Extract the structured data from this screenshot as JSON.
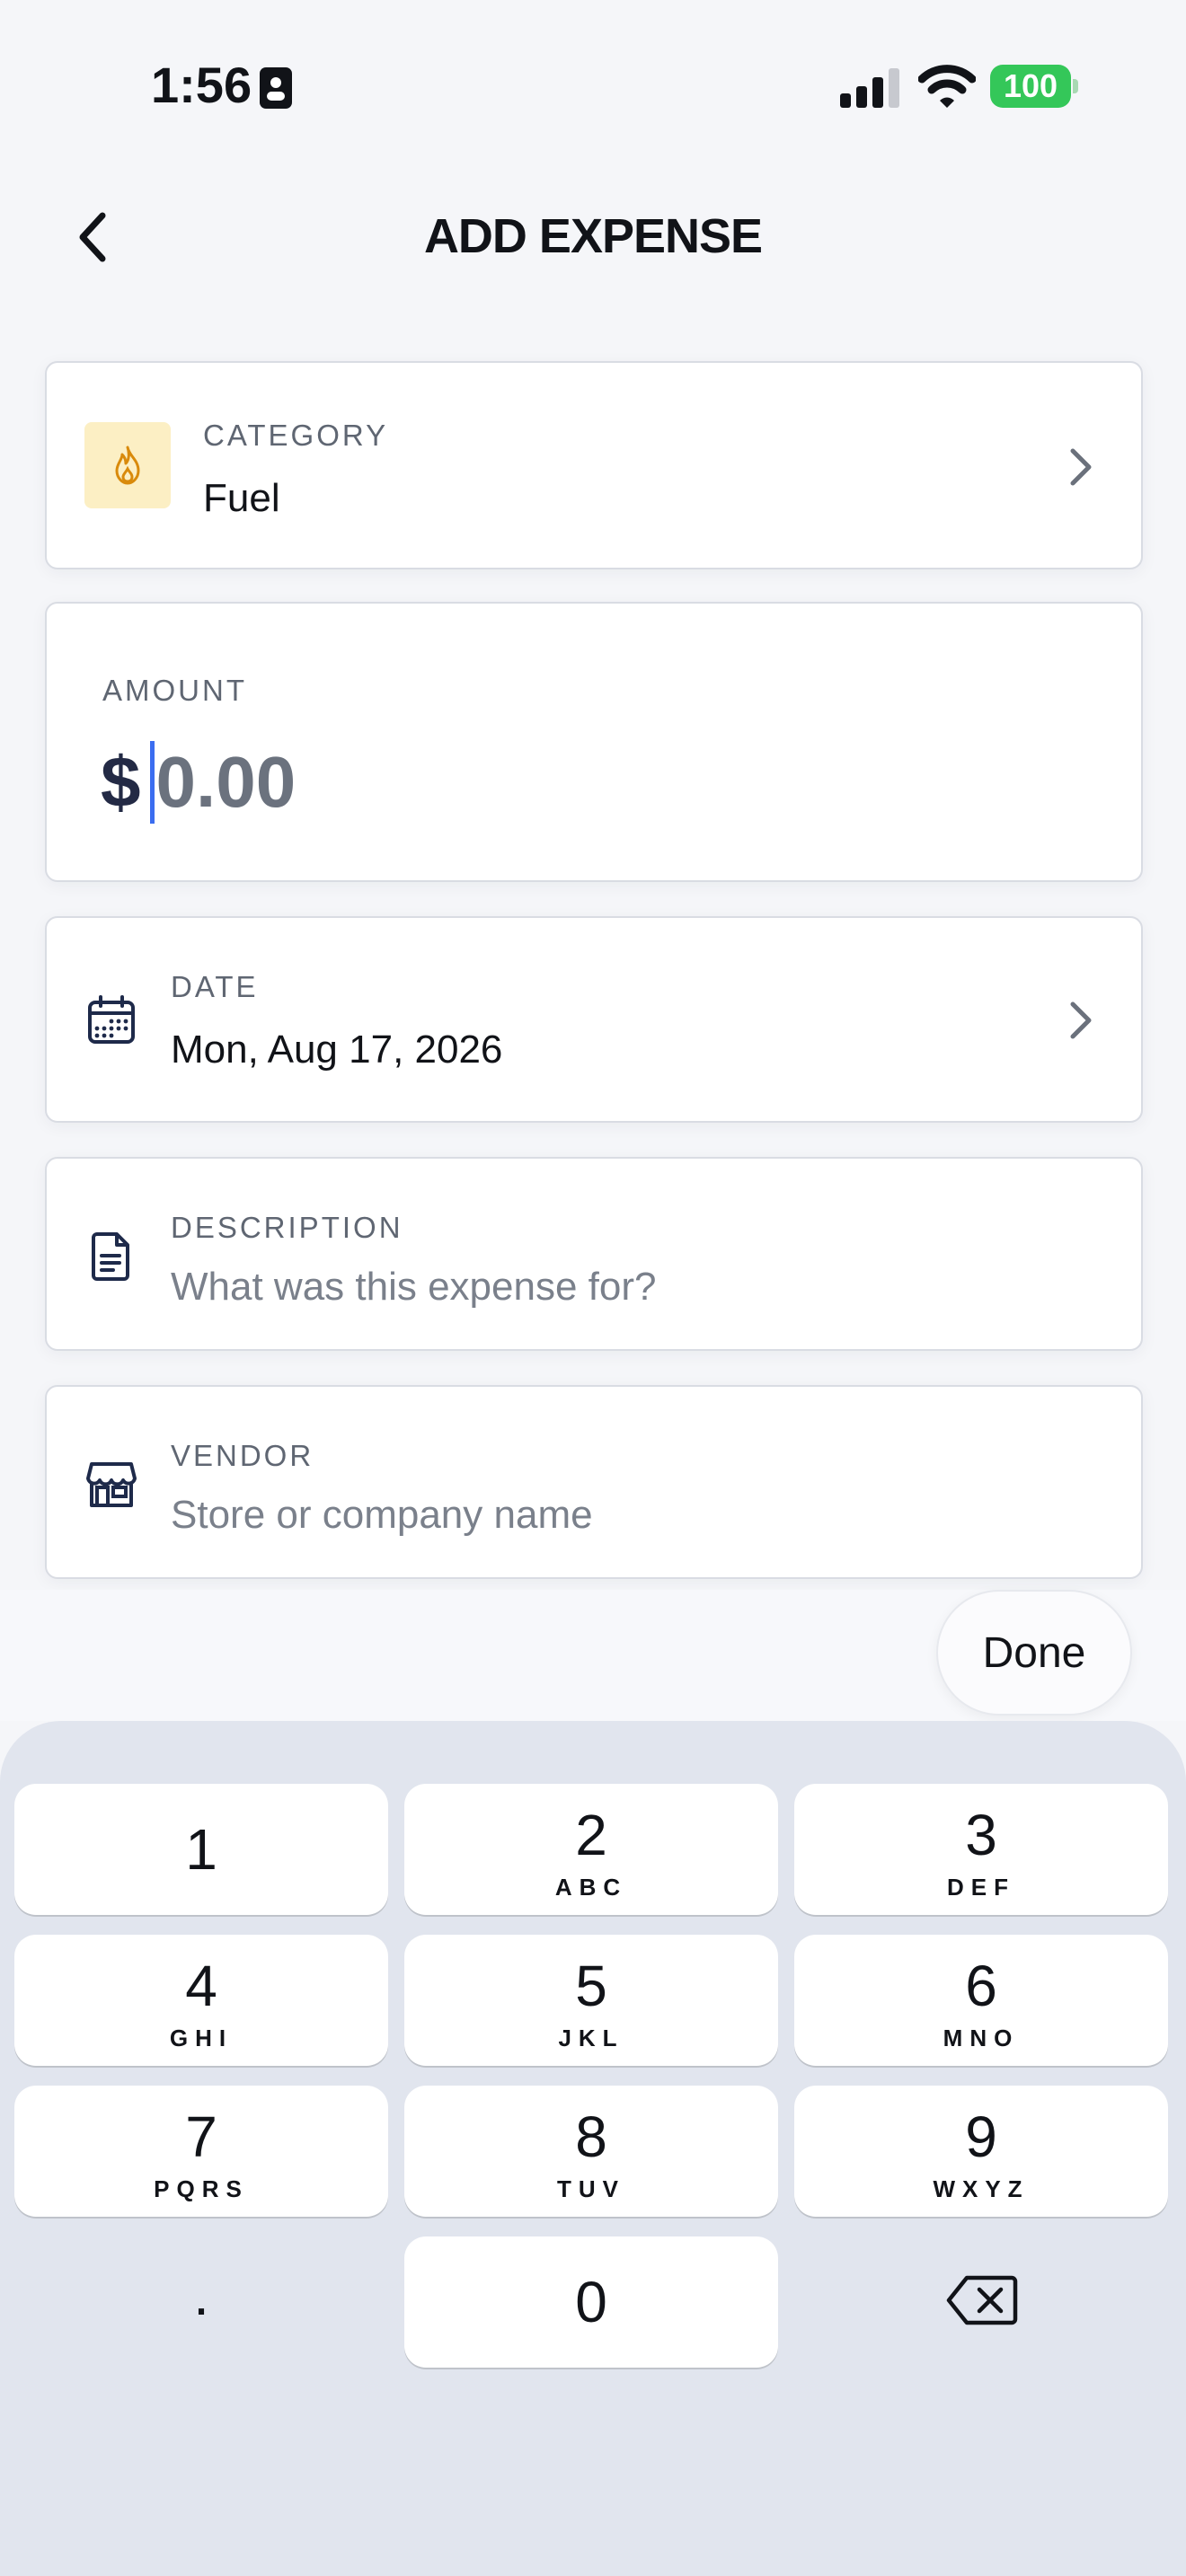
{
  "status_bar": {
    "time": "1:56",
    "battery": "100"
  },
  "header": {
    "title": "ADD EXPENSE"
  },
  "category": {
    "label": "CATEGORY",
    "value": "Fuel"
  },
  "amount": {
    "label": "AMOUNT",
    "currency": "$",
    "value": "0.00"
  },
  "date": {
    "label": "DATE",
    "value": "Mon, Aug 17, 2026"
  },
  "description": {
    "label": "DESCRIPTION",
    "placeholder": "What was this expense for?"
  },
  "vendor": {
    "label": "VENDOR",
    "placeholder": "Store or company name"
  },
  "accessory": {
    "done_label": "Done"
  },
  "keypad": {
    "keys": [
      {
        "digit": "1",
        "letters": ""
      },
      {
        "digit": "2",
        "letters": "ABC"
      },
      {
        "digit": "3",
        "letters": "DEF"
      },
      {
        "digit": "4",
        "letters": "GHI"
      },
      {
        "digit": "5",
        "letters": "JKL"
      },
      {
        "digit": "6",
        "letters": "MNO"
      },
      {
        "digit": "7",
        "letters": "PQRS"
      },
      {
        "digit": "8",
        "letters": "TUV"
      },
      {
        "digit": "9",
        "letters": "WXYZ"
      },
      {
        "digit": ".",
        "letters": ""
      },
      {
        "digit": "0",
        "letters": ""
      }
    ],
    "delete_icon": "delete-backspace-icon"
  },
  "colors": {
    "accent": "#3b6df0",
    "battery": "#34c759",
    "category_icon_bg": "#fcefc4",
    "category_icon": "#d98a0b"
  }
}
